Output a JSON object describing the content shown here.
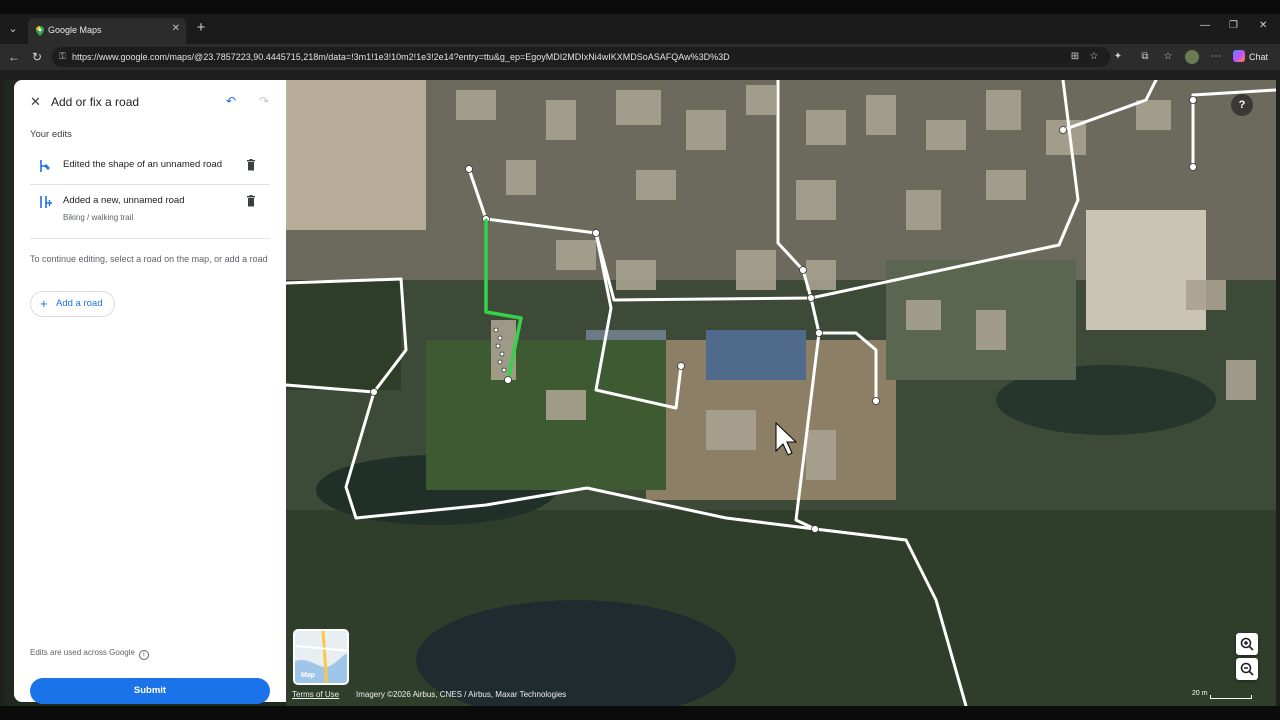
{
  "browser": {
    "tab_title": "Google Maps",
    "url": "https://www.google.com/maps/@23.7857223,90.4445715,218m/data=!3m1!1e3!10m2!1e3!2e14?entry=ttu&g_ep=EgoyMDI2MDIxNi4wIKXMDSoASAFQAw%3D%3D",
    "chat_label": "Chat"
  },
  "panel": {
    "title": "Add or fix a road",
    "section_title": "Your edits",
    "edits": [
      {
        "label": "Edited the shape of an unnamed road",
        "sub": ""
      },
      {
        "label": "Added a new, unnamed road",
        "sub": "Biking / walking trail"
      }
    ],
    "hint": "To continue editing, select a road on the map, or add a road",
    "add_road_label": "Add a road",
    "footnote": "Edits are used across Google",
    "submit_label": "Submit"
  },
  "map": {
    "layer_label": "Map",
    "terms": "Terms of Use",
    "imagery": "Imagery ©2026 Airbus, CNES / Airbus, Maxar Technologies",
    "scale_label": "20 m",
    "colors": {
      "road": "#ffffff",
      "edited_road": "#35d24a",
      "accent": "#1a73e8"
    }
  }
}
